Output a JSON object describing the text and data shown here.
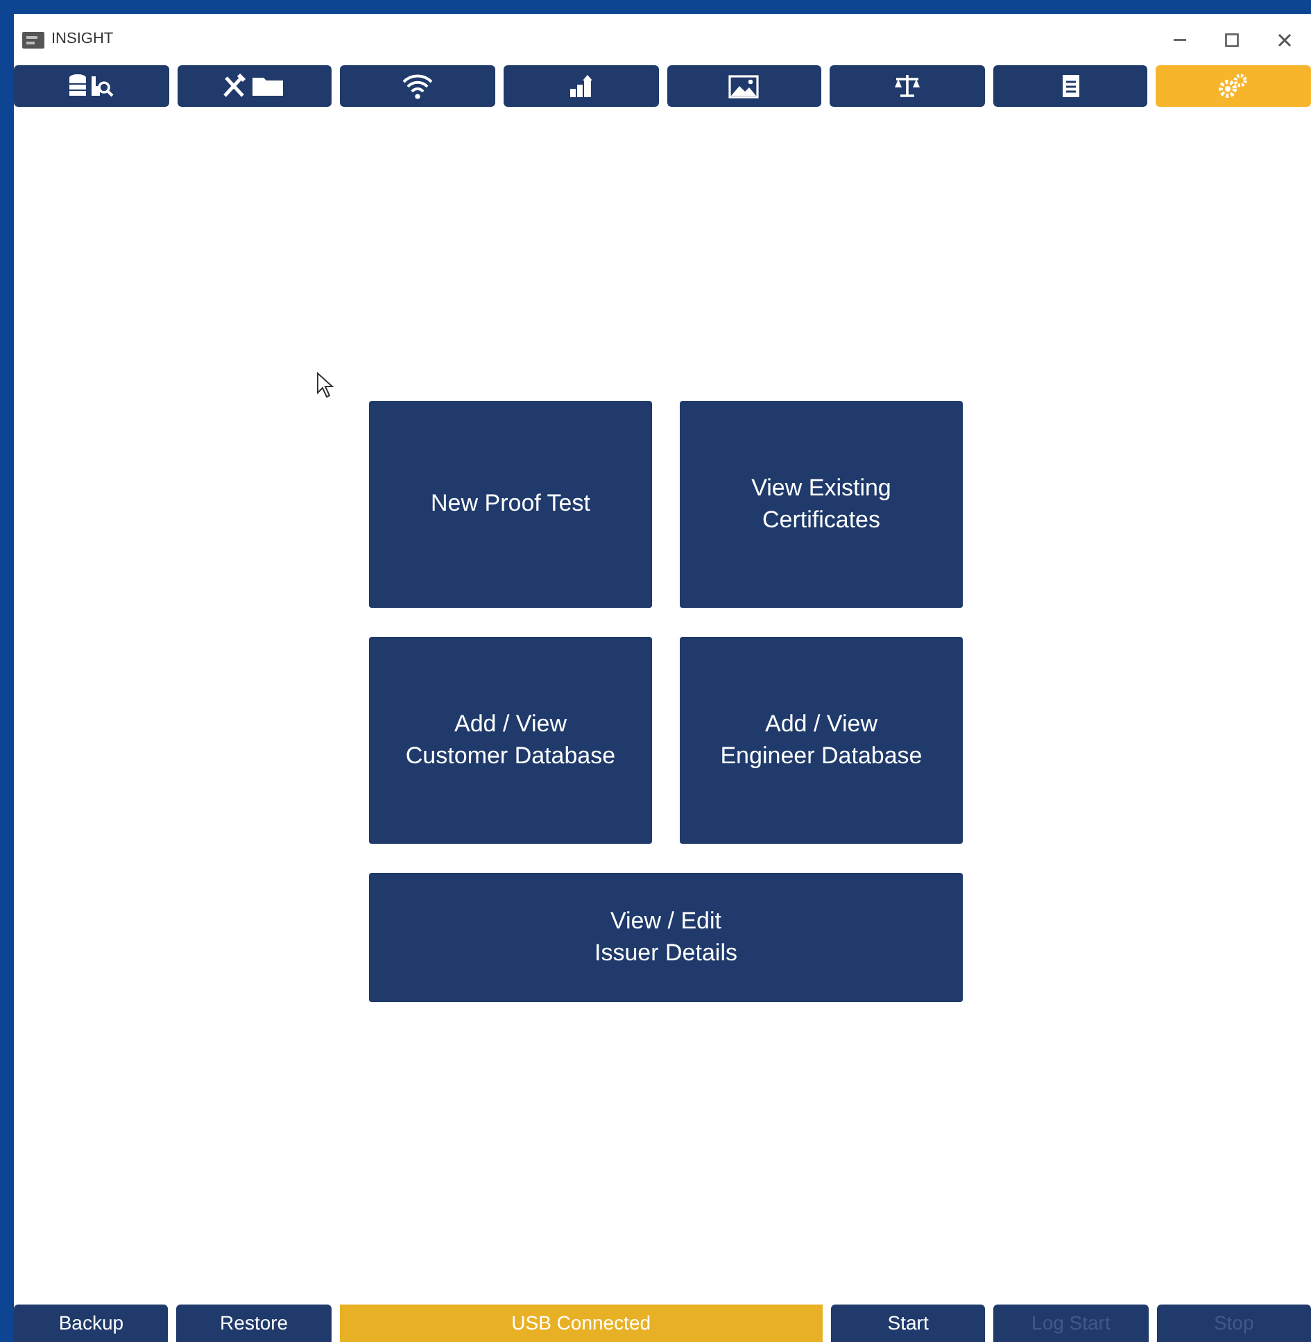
{
  "window": {
    "title": "INSIGHT"
  },
  "tabs": [
    {
      "kind": "database-search",
      "selected": false
    },
    {
      "kind": "tools-folder",
      "selected": false
    },
    {
      "kind": "wifi",
      "selected": false
    },
    {
      "kind": "chart",
      "selected": false
    },
    {
      "kind": "image",
      "selected": false
    },
    {
      "kind": "scale",
      "selected": false
    },
    {
      "kind": "document",
      "selected": false
    },
    {
      "kind": "gears",
      "selected": true
    }
  ],
  "tiles": [
    {
      "label": "New Proof Test",
      "wide": false
    },
    {
      "label": "View Existing\nCertificates",
      "wide": false
    },
    {
      "label": "Add / View\nCustomer Database",
      "wide": false
    },
    {
      "label": "Add / View\nEngineer Database",
      "wide": false
    },
    {
      "label": "View / Edit\nIssuer Details",
      "wide": true
    }
  ],
  "status_bar": [
    {
      "kind": "button",
      "label": "Backup",
      "disabled": false
    },
    {
      "kind": "button",
      "label": "Restore",
      "disabled": false
    },
    {
      "kind": "status",
      "label": "USB Connected"
    },
    {
      "kind": "button",
      "label": "Start",
      "disabled": false
    },
    {
      "kind": "button",
      "label": "Log Start",
      "disabled": true
    },
    {
      "kind": "button",
      "label": "Stop",
      "disabled": true
    }
  ]
}
